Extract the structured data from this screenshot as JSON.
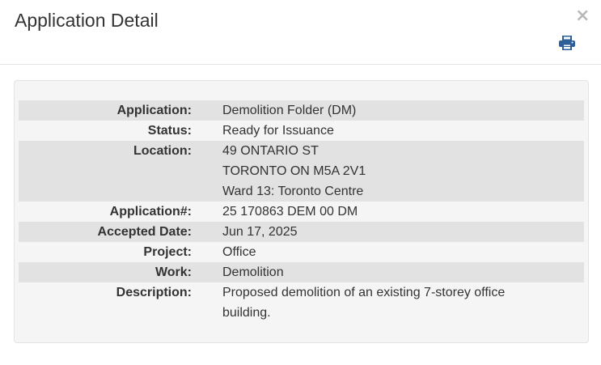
{
  "header": {
    "title": "Application Detail",
    "close_label": "×",
    "print_icon": "print-icon"
  },
  "colors": {
    "panel_background": "#f5f5f5",
    "shaded_row": "#e2e2e2",
    "print_icon": "#2f5f9a",
    "close_icon": "#b8b8b8"
  },
  "details": {
    "application": {
      "label": "Application:",
      "value": "Demolition Folder (DM)"
    },
    "status": {
      "label": "Status:",
      "value": "Ready for Issuance"
    },
    "location": {
      "label": "Location:",
      "line1": "49 ONTARIO ST",
      "line2": "TORONTO ON M5A 2V1",
      "line3": "Ward 13: Toronto Centre"
    },
    "application_number": {
      "label": "Application#:",
      "value": "25 170863 DEM 00 DM"
    },
    "accepted_date": {
      "label": "Accepted Date:",
      "value": "Jun 17, 2025"
    },
    "project": {
      "label": "Project:",
      "value": "Office"
    },
    "work": {
      "label": "Work:",
      "value": "Demolition"
    },
    "description": {
      "label": "Description:",
      "value": "Proposed demolition of an existing 7-storey office building."
    }
  }
}
